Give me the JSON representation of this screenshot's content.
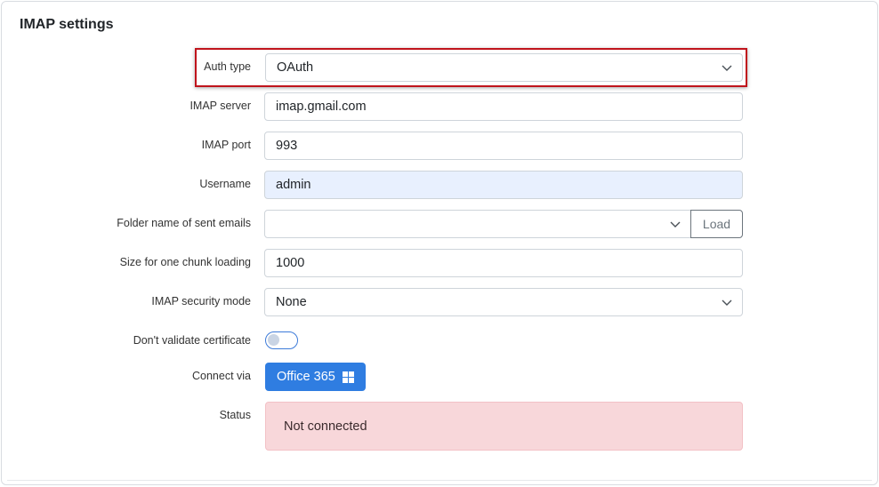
{
  "card": {
    "title": "IMAP settings"
  },
  "fields": {
    "auth_type": {
      "label": "Auth type",
      "value": "OAuth"
    },
    "imap_server": {
      "label": "IMAP server",
      "value": "imap.gmail.com"
    },
    "imap_port": {
      "label": "IMAP port",
      "value": "993"
    },
    "username": {
      "label": "Username",
      "value": "admin"
    },
    "sent_folder": {
      "label": "Folder name of sent emails",
      "value": "",
      "load_label": "Load"
    },
    "chunk_size": {
      "label": "Size for one chunk loading",
      "value": "1000"
    },
    "security_mode": {
      "label": "IMAP security mode",
      "value": "None"
    },
    "validate_cert": {
      "label": "Don't validate certificate",
      "enabled": false
    },
    "connect_via": {
      "label": "Connect via",
      "button_label": "Office 365",
      "button_icon": "windows-icon"
    },
    "status": {
      "label": "Status",
      "value": "Not connected"
    }
  },
  "colors": {
    "highlight_border": "#c0141c",
    "primary_button": "#2f7de1",
    "status_bg": "#f8d7da",
    "readonly_bg": "#e8f0fe"
  }
}
